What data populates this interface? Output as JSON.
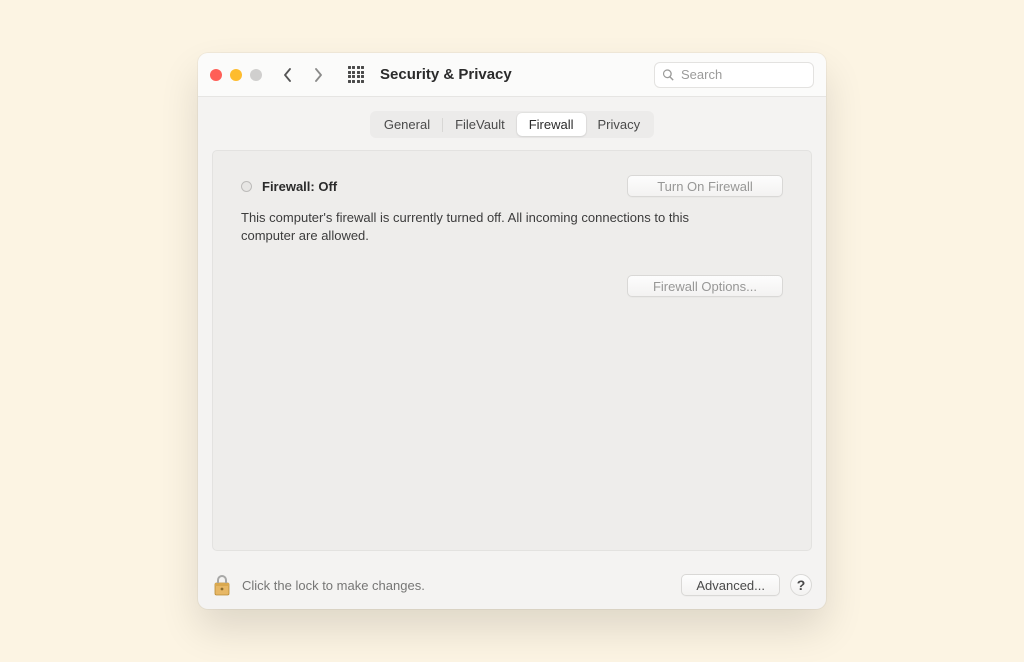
{
  "window": {
    "title": "Security & Privacy"
  },
  "search": {
    "placeholder": "Search",
    "value": ""
  },
  "tabs": {
    "items": [
      {
        "label": "General"
      },
      {
        "label": "FileVault"
      },
      {
        "label": "Firewall"
      },
      {
        "label": "Privacy"
      }
    ],
    "active_index": 2
  },
  "firewall": {
    "status_label": "Firewall: Off",
    "turn_on_label": "Turn On Firewall",
    "description": "This computer's firewall is currently turned off. All incoming connections to this computer are allowed.",
    "options_label": "Firewall Options..."
  },
  "footer": {
    "lock_text": "Click the lock to make changes.",
    "advanced_label": "Advanced...",
    "help_label": "?"
  },
  "colors": {
    "page_bg": "#fcf4e3",
    "window_bg": "#f4f3f2",
    "panel_bg": "#eeedeb",
    "text": "#2b2b2b"
  }
}
